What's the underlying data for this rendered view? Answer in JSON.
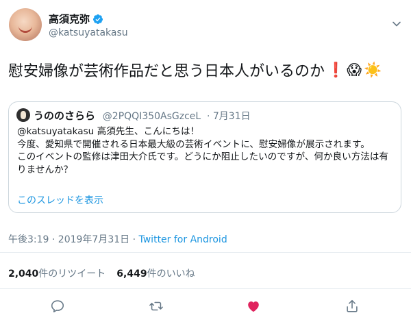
{
  "author": {
    "name": "高須克弥",
    "handle": "@katsuyatakasu"
  },
  "tweet": {
    "text": "慰安婦像が芸術作品だと思う日本人がいるのか",
    "emojis": [
      "❗",
      "😱",
      "☀️"
    ]
  },
  "quoted": {
    "name": "うののさらら",
    "handle": "@2PQQI350AsGzceL",
    "date": "· 7月31日",
    "body": "@katsuyatakasu 高須先生、こんにちは！\n今度、愛知県で開催される日本最大級の芸術イベントに、慰安婦像が展示されます。\nこのイベントの監修は津田大介氏です。どうにか阻止したいのですが、何か良い方法は有りませんか？",
    "thread_link": "このスレッドを表示"
  },
  "meta": {
    "time": "午後3:19 · 2019年7月31日 · ",
    "source": "Twitter for Android"
  },
  "stats": {
    "retweets": "2,040",
    "retweets_label": "件のリツイート",
    "likes": "6,449",
    "likes_label": "件のいいね"
  },
  "icons": [
    "verified-icon",
    "chevron-down-icon",
    "reply-icon",
    "retweet-icon",
    "like-icon",
    "share-icon"
  ],
  "colors": {
    "accent": "#1b95e0",
    "like": "#e0245e",
    "muted": "#657786"
  }
}
